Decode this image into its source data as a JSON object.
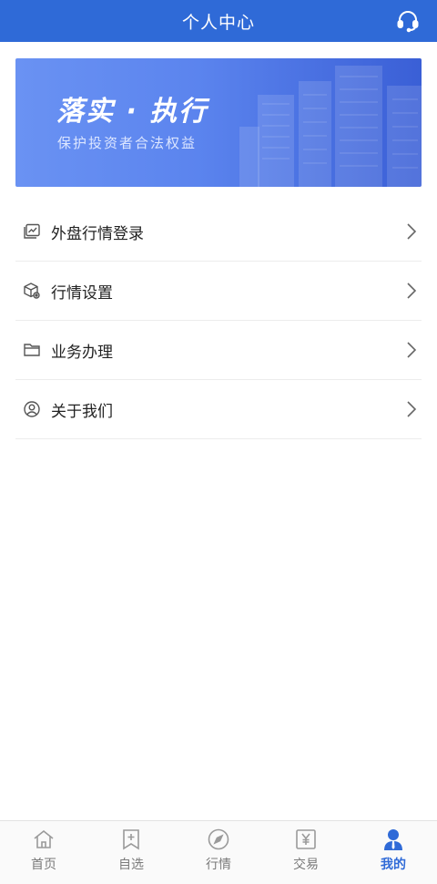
{
  "header": {
    "title": "个人中心",
    "support_icon": "headset-icon"
  },
  "banner": {
    "title": "落实 · 执行",
    "subtitle": "保护投资者合法权益"
  },
  "menu": {
    "items": [
      {
        "label": "外盘行情登录",
        "icon": "chart-window-icon"
      },
      {
        "label": "行情设置",
        "icon": "cube-settings-icon"
      },
      {
        "label": "业务办理",
        "icon": "folder-icon"
      },
      {
        "label": "关于我们",
        "icon": "user-circle-icon"
      }
    ]
  },
  "tabbar": {
    "items": [
      {
        "label": "首页",
        "icon": "home-icon"
      },
      {
        "label": "自选",
        "icon": "bookmark-add-icon"
      },
      {
        "label": "行情",
        "icon": "compass-icon"
      },
      {
        "label": "交易",
        "icon": "yen-note-icon"
      },
      {
        "label": "我的",
        "icon": "person-icon",
        "active": true
      }
    ]
  },
  "colors": {
    "brand": "#2f6ad7",
    "inactive": "#7a7a7a",
    "divider": "#ececec"
  }
}
